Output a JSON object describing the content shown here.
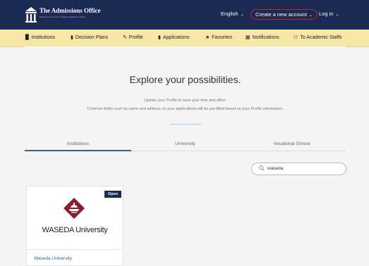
{
  "header": {
    "brand_name": "The Admissions Office",
    "brand_tagline": "Making the process of college admissions simple",
    "language": "English",
    "create_account": "Create a new account",
    "login": "Log in"
  },
  "nav": {
    "items": [
      {
        "label": "Institutions",
        "icon": "institution-icon"
      },
      {
        "label": "Decision Plans",
        "icon": "document-icon"
      },
      {
        "label": "Profile",
        "icon": "edit-icon"
      },
      {
        "label": "Applications",
        "icon": "document-icon"
      },
      {
        "label": "Favorites",
        "icon": "star-icon"
      },
      {
        "label": "Notifications",
        "icon": "notification-icon"
      },
      {
        "label": "To Academic Staffs",
        "icon": "people-icon"
      }
    ]
  },
  "main": {
    "headline": "Explore your possibilities.",
    "subtitle1": "Update your Profile to save your time and effort.",
    "subtitle2": "Common fields such as name and address on your applications will be pre-filled based on your Profile information.",
    "tabs": [
      {
        "label": "Institutions",
        "active": true
      },
      {
        "label": "University",
        "active": false
      },
      {
        "label": "Vocational School",
        "active": false
      }
    ],
    "search": {
      "value": "waseda"
    },
    "cards": [
      {
        "badge": "Open",
        "logo_text": "WASEDA University",
        "name": "Waseda University"
      }
    ]
  },
  "colors": {
    "header_bg": "#1a2a52",
    "nav_bg": "#f6e7a6",
    "highlight": "#d0202a",
    "accent": "#2a6496",
    "crest": "#8b1c2b"
  }
}
